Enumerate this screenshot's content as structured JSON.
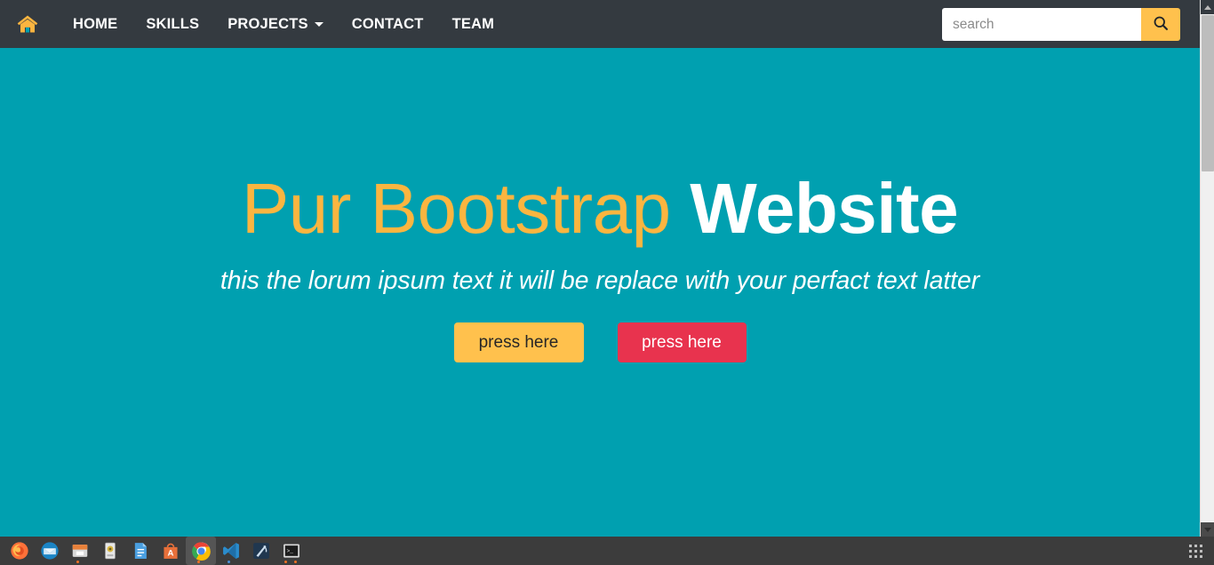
{
  "navbar": {
    "home_icon": "home-icon",
    "links": [
      {
        "label": "HOME",
        "has_caret": false
      },
      {
        "label": "SKILLS",
        "has_caret": false
      },
      {
        "label": "PROJECTS",
        "has_caret": true
      },
      {
        "label": "CONTACT",
        "has_caret": false
      },
      {
        "label": "TEAM",
        "has_caret": false
      }
    ],
    "search": {
      "placeholder": "search",
      "value": "",
      "button_icon": "search-icon"
    },
    "background_color": "#343a40",
    "accent_color": "#ffc14d"
  },
  "hero": {
    "title_plain": "Pur Bootstrap ",
    "title_accent": "Website",
    "subtitle": "this the lorum ipsum text it will be replace with your perfact text latter",
    "buttons": [
      {
        "label": "press here",
        "style": "amber",
        "color": "#ffc14d"
      },
      {
        "label": "press here",
        "style": "red",
        "color": "#e8334e"
      }
    ],
    "background_color": "#00a0b0",
    "title_color": "#fbb540",
    "accent_color": "#ffffff"
  },
  "scrollbar": {
    "up_arrow": "scroll-up-arrow-icon",
    "down_arrow": "scroll-down-arrow-icon"
  },
  "taskbar": {
    "background_color": "#3c3c3c",
    "items": [
      {
        "name": "firefox",
        "icon": "firefox-icon",
        "active": false,
        "dots": 0
      },
      {
        "name": "thunderbird",
        "icon": "thunderbird-icon",
        "active": false,
        "dots": 0
      },
      {
        "name": "file-manager",
        "icon": "file-manager-icon",
        "active": false,
        "dots": 1
      },
      {
        "name": "disk-utility",
        "icon": "disk-utility-icon",
        "active": false,
        "dots": 0
      },
      {
        "name": "text-editor",
        "icon": "text-editor-icon",
        "active": false,
        "dots": 0
      },
      {
        "name": "software-center",
        "icon": "software-center-icon",
        "active": false,
        "dots": 0
      },
      {
        "name": "google-chrome",
        "icon": "chrome-icon",
        "active": true,
        "dots": 1
      },
      {
        "name": "vs-code",
        "icon": "vscode-icon",
        "active": false,
        "dots": 1
      },
      {
        "name": "qt-creator",
        "icon": "qt-creator-icon",
        "active": false,
        "dots": 0
      },
      {
        "name": "terminal",
        "icon": "terminal-icon",
        "active": false,
        "dots": 2
      }
    ],
    "launcher": "app-grid-icon"
  }
}
